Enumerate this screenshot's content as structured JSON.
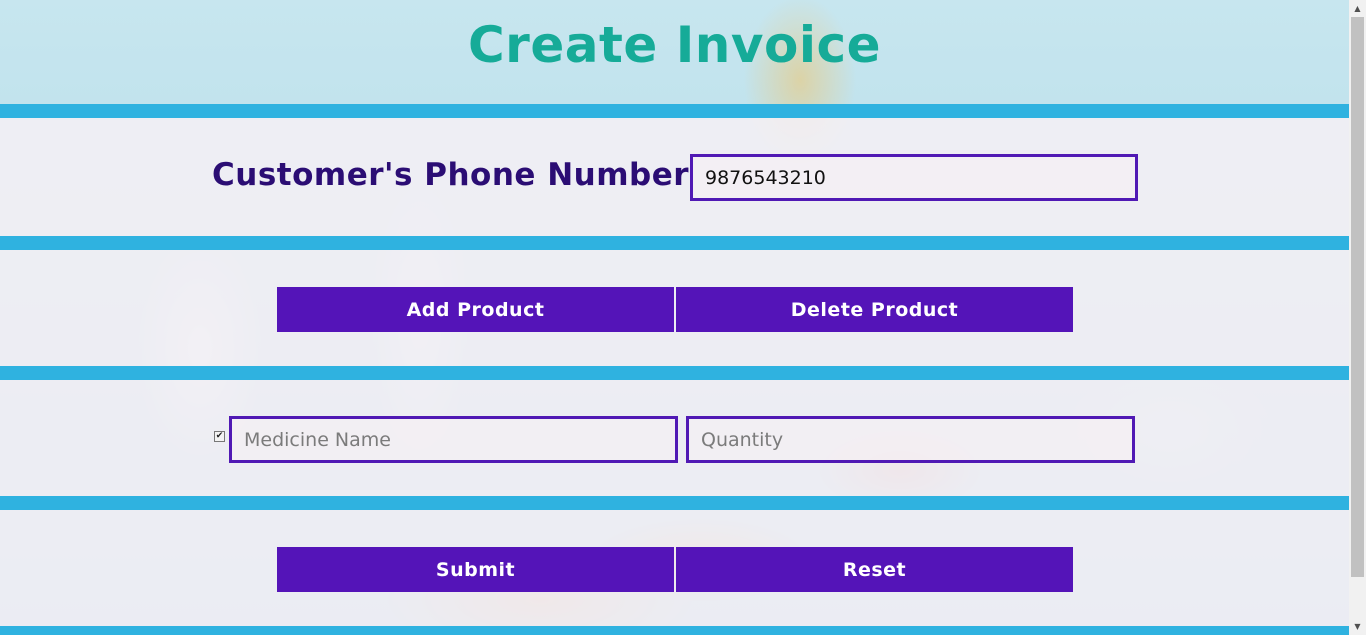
{
  "page": {
    "title": "Create Invoice",
    "colors": {
      "title": "#16ab98",
      "label": "#2b0d74",
      "accent": "#5414b8",
      "band_border": "#2fb2e0"
    }
  },
  "customer": {
    "phone_label": "Customer's Phone Number",
    "phone_value": "9876543210"
  },
  "product_actions": {
    "add_label": "Add Product",
    "delete_label": "Delete Product"
  },
  "product_row": {
    "checked": true,
    "medicine_placeholder": "Medicine Name",
    "medicine_value": "",
    "quantity_placeholder": "Quantity",
    "quantity_value": ""
  },
  "form_actions": {
    "submit_label": "Submit",
    "reset_label": "Reset"
  },
  "scrollbar": {
    "up_icon": "scroll-up-arrow-icon",
    "down_icon": "scroll-down-arrow-icon"
  }
}
